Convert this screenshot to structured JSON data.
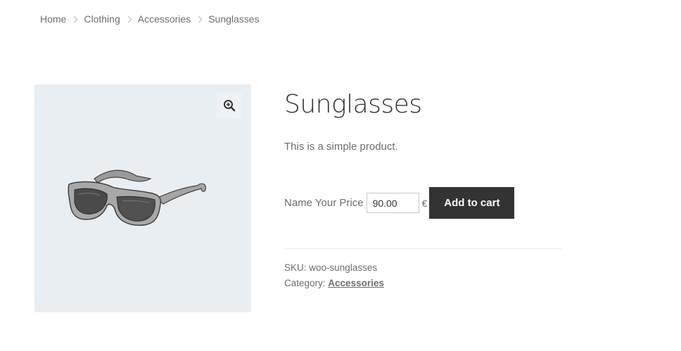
{
  "breadcrumb": {
    "items": [
      "Home",
      "Clothing",
      "Accessories",
      "Sunglasses"
    ]
  },
  "gallery": {
    "zoom_icon": "zoom-in-icon",
    "image_subject": "sunglasses"
  },
  "product": {
    "title": "Sunglasses",
    "description": "This is a simple product.",
    "price_label": "Name Your Price",
    "price_value": "90.00",
    "currency": "€",
    "add_to_cart_label": "Add to cart",
    "sku_label": "SKU:",
    "sku_value": "woo-sunglasses",
    "category_label": "Category:",
    "category_value": "Accessories"
  },
  "colors": {
    "button_bg": "#333333",
    "gallery_bg": "#e9eef2",
    "text": "#6d6d6d"
  }
}
